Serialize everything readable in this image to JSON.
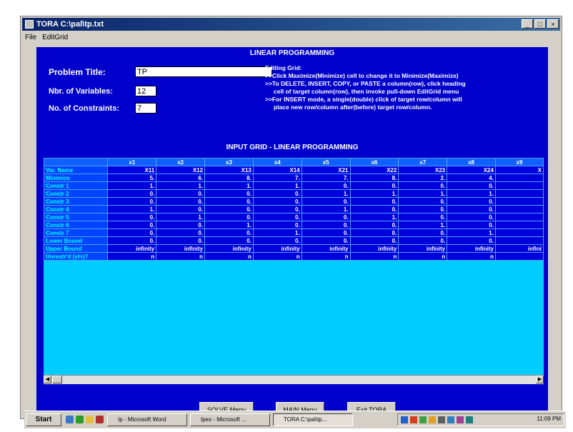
{
  "window": {
    "title": "TORA C:\\pal\\tp.txt",
    "controls": [
      "_",
      "□",
      "×"
    ]
  },
  "menu": {
    "items": [
      "File",
      "EditGrid"
    ]
  },
  "app": {
    "heading": "LINEAR PROGRAMMING",
    "problem_title": {
      "label": "Problem Title:",
      "value": "TP"
    },
    "num_variables": {
      "label": "Nbr. of Variables:",
      "value": "12"
    },
    "num_constraints": {
      "label": "No. of Constraints:",
      "value": "7"
    },
    "help": {
      "title": "Editing Grid:",
      "lines": [
        ">>Click Maximize(Minimize) cell to change it to Minimize(Maximize)",
        ">>To DELETE, INSERT, COPY, or PASTE a column(row), click heading",
        "cell of target column(row), then invoke pull-down EditGrid menu",
        ">>For INSERT mode, a single(double) click of target row/column will",
        "place new row/column after(before) target row/column."
      ]
    },
    "grid_title": "INPUT GRID - LINEAR PROGRAMMING",
    "grid": {
      "columns": [
        "x1",
        "x2",
        "x3",
        "x4",
        "x5",
        "x6",
        "x7",
        "x8",
        "x9"
      ],
      "rows": [
        {
          "label": "Var. Name",
          "cells": [
            "X11",
            "X12",
            "X13",
            "X14",
            "X21",
            "X22",
            "X23",
            "X24",
            "X"
          ]
        },
        {
          "label": "Minimize",
          "cells": [
            "5.",
            "6.",
            "8.",
            "7.",
            "7.",
            "8.",
            "2.",
            "4.",
            ""
          ]
        },
        {
          "label": "Constr 1",
          "cells": [
            "1.",
            "1.",
            "1.",
            "1.",
            "0.",
            "0.",
            "0.",
            "0.",
            ""
          ]
        },
        {
          "label": "Constr 2",
          "cells": [
            "0.",
            "0.",
            "0.",
            "0.",
            "1.",
            "1.",
            "1.",
            "1.",
            ""
          ]
        },
        {
          "label": "Constr 3",
          "cells": [
            "0.",
            "0.",
            "0.",
            "0.",
            "0.",
            "0.",
            "0.",
            "0.",
            ""
          ]
        },
        {
          "label": "Constr 4",
          "cells": [
            "1.",
            "0.",
            "0.",
            "0.",
            "1.",
            "0.",
            "0.",
            "0.",
            ""
          ]
        },
        {
          "label": "Constr 5",
          "cells": [
            "0.",
            "1.",
            "0.",
            "0.",
            "0.",
            "1.",
            "0.",
            "0.",
            ""
          ]
        },
        {
          "label": "Constr 6",
          "cells": [
            "0.",
            "0.",
            "1.",
            "0.",
            "0.",
            "0.",
            "1.",
            "0.",
            ""
          ]
        },
        {
          "label": "Constr 7",
          "cells": [
            "0.",
            "0.",
            "0.",
            "1.",
            "0.",
            "0.",
            "0.",
            "1.",
            ""
          ]
        },
        {
          "label": "Lower Bound",
          "cells": [
            "0.",
            "0.",
            "0.",
            "0.",
            "0.",
            "0.",
            "0.",
            "0.",
            ""
          ]
        },
        {
          "label": "Upper Bound",
          "cells": [
            "infinity",
            "infinity",
            "infinity",
            "infinity",
            "infinity",
            "infinity",
            "infinity",
            "infinity",
            "infini"
          ]
        },
        {
          "label": "Unrestr'd (y/n)?",
          "cells": [
            "n",
            "n",
            "n",
            "n",
            "n",
            "n",
            "n",
            "n",
            ""
          ]
        }
      ]
    },
    "buttons": {
      "solve": "SOLVE Menu",
      "main": "MAIN Menu",
      "exit": "Exit TORA"
    }
  },
  "taskbar": {
    "start": "Start",
    "tasks": [
      "Ip - Microsoft Word",
      "Ipex - Microsoft ...",
      "TORA C:\\pal\\tp..."
    ],
    "clock": "11:09 PM"
  },
  "colors": {
    "app_bg": "#0000cc",
    "grid_bg": "#00ccff",
    "cell_bg": "#0000dd",
    "title_bar": "#0a246a"
  }
}
